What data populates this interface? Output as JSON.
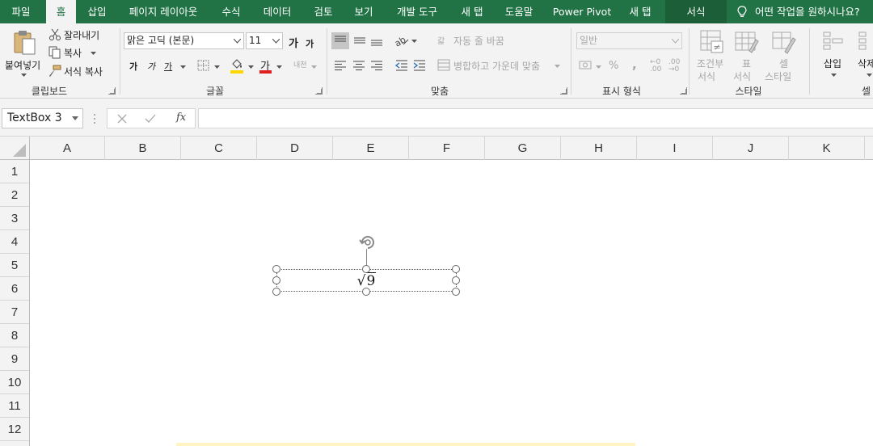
{
  "tabs": {
    "file": "파일",
    "home": "홈",
    "insert": "삽입",
    "page_layout": "페이지 레이아웃",
    "formulas": "수식",
    "data": "데이터",
    "review": "검토",
    "view": "보기",
    "developer": "개발 도구",
    "new_tab_1": "새 탭",
    "help": "도움말",
    "power_pivot": "Power Pivot",
    "new_tab_2": "새 탭",
    "format": "서식"
  },
  "tell_me": "어떤 작업을 원하시나요?",
  "clipboard": {
    "paste": "붙여넣기",
    "cut": "잘라내기",
    "copy": "복사",
    "format_painter": "서식 복사",
    "label": "클립보드"
  },
  "font": {
    "name": "맑은 고딕 (본문)",
    "size": "11",
    "grow_glyph": "가",
    "shrink_glyph": "가",
    "bold_glyph": "가",
    "italic_glyph": "가",
    "underline_glyph": "가",
    "color_glyph": "가",
    "phonetic_glyph": "내천",
    "label": "글꼴",
    "font_color": "#e02020",
    "highlight_color": "#ffd700"
  },
  "alignment": {
    "wrap_text": "자동 줄 바꿈",
    "wrap_glyph": "갋",
    "merge_center": "병합하고 가운데 맞춤",
    "label": "맞춤"
  },
  "number": {
    "format": "일반",
    "percent": "%",
    "comma": ",",
    "inc_decimal": "←0 .00",
    "dec_decimal": ".00 →0",
    "label": "표시 형식"
  },
  "styles": {
    "conditional": [
      "조건부",
      "서식"
    ],
    "table": [
      "표",
      "서식"
    ],
    "cell": [
      "셀",
      "스타일"
    ],
    "label": "스타일"
  },
  "cells": {
    "insert": "삽입",
    "delete": "삭제",
    "label": "셀"
  },
  "formula_bar": {
    "name_box": "TextBox 3",
    "fx": "fx",
    "content": ""
  },
  "columns": [
    "A",
    "B",
    "C",
    "D",
    "E",
    "F",
    "G",
    "H",
    "I",
    "J",
    "K"
  ],
  "rows": [
    "1",
    "2",
    "3",
    "4",
    "5",
    "6",
    "7",
    "8",
    "9",
    "10",
    "11",
    "12"
  ],
  "textbox": {
    "radical": "√",
    "radicand": "9"
  }
}
